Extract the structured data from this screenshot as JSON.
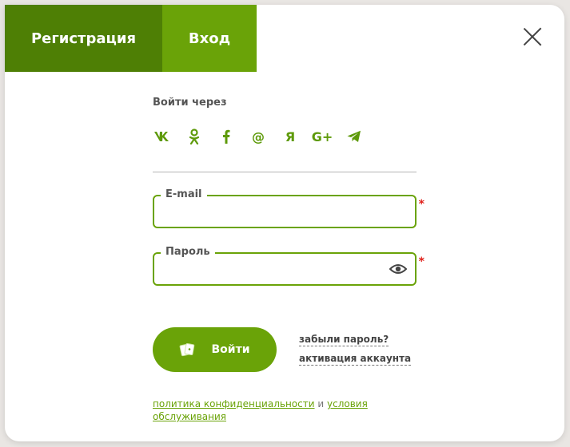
{
  "tabs": {
    "register": "Регистрация",
    "login": "Вход"
  },
  "login_via": "Войти через",
  "socials": [
    {
      "icon": "vk-icon",
      "label": "vk"
    },
    {
      "icon": "odnoklassniki-icon",
      "label": "ok"
    },
    {
      "icon": "facebook-icon",
      "label": "f"
    },
    {
      "icon": "mail-icon",
      "label": "@"
    },
    {
      "icon": "yandex-icon",
      "label": "Я"
    },
    {
      "icon": "google-plus-icon",
      "label": "G+"
    },
    {
      "icon": "telegram-icon",
      "label": ""
    }
  ],
  "email": {
    "label": "E-mail",
    "value": "",
    "placeholder": ""
  },
  "password": {
    "label": "Пароль",
    "value": "",
    "placeholder": ""
  },
  "required_mark": "*",
  "submit_label": "Войти",
  "links": {
    "forgot": "забыли пароль?",
    "activate": "активация аккаунта"
  },
  "policy": {
    "privacy": "политика конфиденциальности",
    "and": "и",
    "terms": "условия обслуживания"
  },
  "colors": {
    "accent": "#6aa308",
    "accent_dark": "#4e7f05",
    "required": "#e0201a"
  }
}
